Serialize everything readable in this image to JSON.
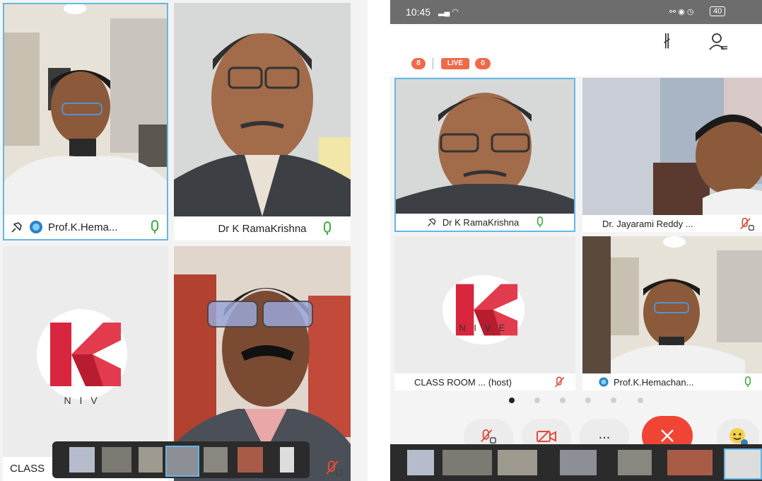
{
  "left": {
    "tiles": [
      {
        "label": "Prof.K.Hema..."
      },
      {
        "label": "Dr K RamaKrishna"
      },
      {
        "label": "CLASS"
      },
      {
        "label": ""
      }
    ],
    "logo_text": "N I V"
  },
  "right": {
    "status": {
      "time": "10:45",
      "right": "40"
    },
    "badges": {
      "count": "8",
      "live": "LIVE",
      "viewers": "0"
    },
    "tiles": [
      {
        "label": "Dr K RamaKrishna"
      },
      {
        "label": "Dr. Jayarami Reddy ..."
      },
      {
        "label": "CLASS ROOM ... (host)"
      },
      {
        "label": "Prof.K.Hemachan..."
      }
    ],
    "logo_text": "N I V E",
    "more_label": "..."
  },
  "colors": {
    "accent": "#63b7e6",
    "mic_green": "#3fae3f",
    "mute_red": "#e44a3a",
    "end_call": "#f04535",
    "live_red": "#f06a4a"
  }
}
